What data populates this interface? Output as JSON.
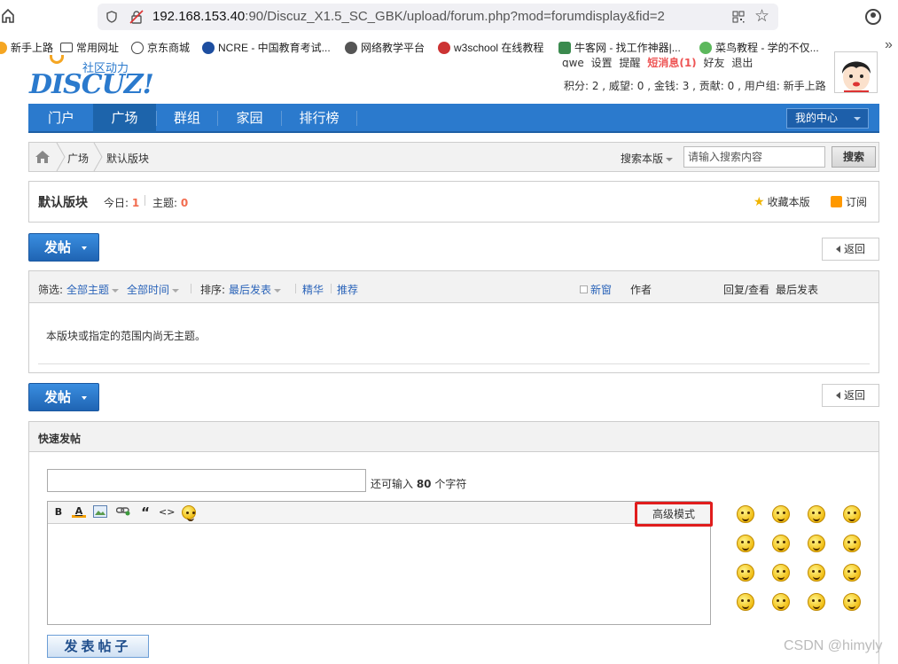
{
  "browser": {
    "url_host": "192.168.153.40",
    "url_rest": ":90/Discuz_X1.5_SC_GBK/upload/forum.php?mod=forumdisplay&fid=2",
    "bookmarks": [
      "新手上路",
      "常用网址",
      "京东商城",
      "NCRE - 中国教育考试...",
      "网络教学平台",
      "w3school 在线教程",
      "牛客网 - 找工作神器|...",
      "菜鸟教程 - 学的不仅..."
    ],
    "bookmark_more": "»"
  },
  "logo": {
    "cn": "社区动力",
    "en": "DISCUZ!"
  },
  "user": {
    "top_links": [
      "qwe",
      "设置",
      "提醒",
      "短消息(1)",
      "好友",
      "退出"
    ],
    "stats": "积分: 2 , 威望: 0 , 金钱: 3 , 贡献: 0 , 用户组: 新手上路"
  },
  "nav": {
    "items": [
      "门户",
      "广场",
      "群组",
      "家园",
      "排行榜"
    ],
    "active": "广场",
    "my_center": "我的中心"
  },
  "breadcrumb": {
    "items": [
      "广场",
      "默认版块"
    ],
    "search_scope": "搜索本版",
    "search_placeholder": "请输入搜索内容",
    "search_button": "搜索"
  },
  "forum": {
    "name": "默认版块",
    "today_label": "今日: ",
    "today_count": "1",
    "topics_label": "主题: ",
    "topics_count": "0",
    "favorite": "收藏本版",
    "subscribe": "订阅"
  },
  "actions": {
    "post": "发帖",
    "back": "返回"
  },
  "filter": {
    "label": "筛选:",
    "all_topics": "全部主题",
    "all_time": "全部时间",
    "sort_label": "排序:",
    "sort_value": "最后发表",
    "digest": "精华",
    "recommend": "推荐",
    "new_window": "新窗",
    "author": "作者",
    "reply_view": "回复/查看",
    "last_post": "最后发表"
  },
  "empty_message": "本版块或指定的范围内尚无主题。",
  "quick_post": {
    "title": "快速发帖",
    "remain_prefix": "还可输入 ",
    "remain_count": "80",
    "remain_suffix": " 个字符",
    "toolbar": [
      "B",
      "A",
      "image",
      "link",
      "“",
      "<>",
      "smiley"
    ],
    "advanced_mode": "高级模式",
    "submit": "发表帖子",
    "smiley_count": 16
  },
  "watermark": "CSDN @himyly"
}
